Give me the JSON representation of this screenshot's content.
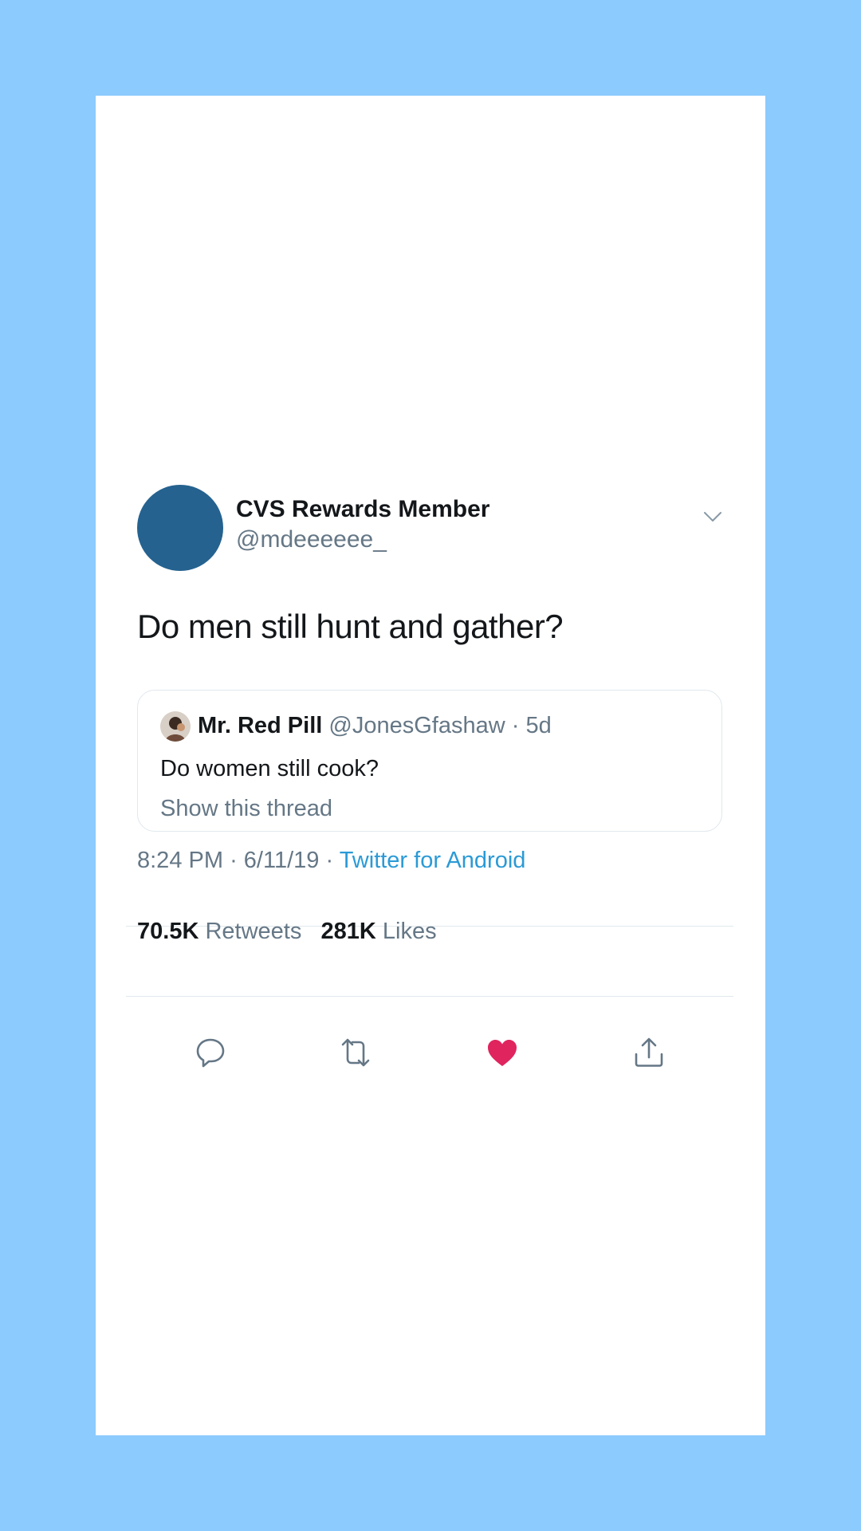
{
  "colors": {
    "background": "#8ccbfe",
    "card": "#ffffff",
    "avatar": "#25628f",
    "text_primary": "#14171a",
    "text_secondary": "#657786",
    "link": "#2b9ad6",
    "like": "#e0245e"
  },
  "tweet": {
    "display_name": "CVS Rewards Member",
    "handle": "@mdeeeeee_",
    "text": "Do men still hunt and gather?",
    "menu_icon": "chevron-down-icon"
  },
  "quote": {
    "display_name": "Mr. Red Pill",
    "handle": "@JonesGfashaw",
    "separator": "·",
    "age": "5d",
    "text": "Do women still cook?",
    "show_thread": "Show this thread"
  },
  "meta": {
    "time": "8:24 PM",
    "separator": "·",
    "date": "6/11/19",
    "source": "Twitter for Android"
  },
  "stats": {
    "retweets_count": "70.5K",
    "retweets_label": "Retweets",
    "likes_count": "281K",
    "likes_label": "Likes"
  },
  "actions": {
    "reply_icon": "reply-icon",
    "retweet_icon": "retweet-icon",
    "like_icon": "heart-icon",
    "liked": true,
    "share_icon": "share-icon"
  }
}
